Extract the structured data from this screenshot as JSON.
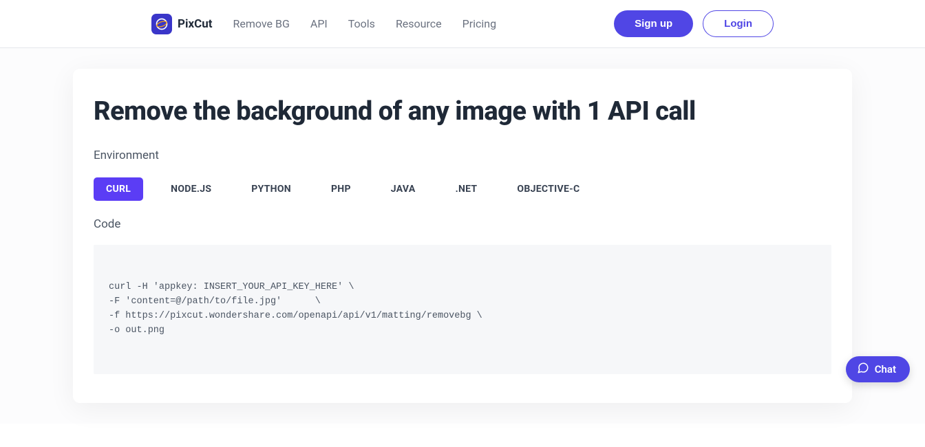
{
  "brand": "PixCut",
  "nav": {
    "remove_bg": "Remove BG",
    "api": "API",
    "tools": "Tools",
    "resource": "Resource",
    "pricing": "Pricing"
  },
  "auth": {
    "signup": "Sign up",
    "login": "Login"
  },
  "main": {
    "title": "Remove the background of any image with 1 API call",
    "env_label": "Environment",
    "tabs": {
      "curl": "CURL",
      "node": "NODE.JS",
      "python": "PYTHON",
      "php": "PHP",
      "java": "JAVA",
      "dotnet": ".NET",
      "objc": "OBJECTIVE-C"
    },
    "code_label": "Code",
    "code_content": "curl -H 'appkey: INSERT_YOUR_API_KEY_HERE' \\\n-F 'content=@/path/to/file.jpg'      \\\n-f https://pixcut.wondershare.com/openapi/api/v1/matting/removebg \\\n-o out.png"
  },
  "chat": {
    "label": "Chat"
  }
}
